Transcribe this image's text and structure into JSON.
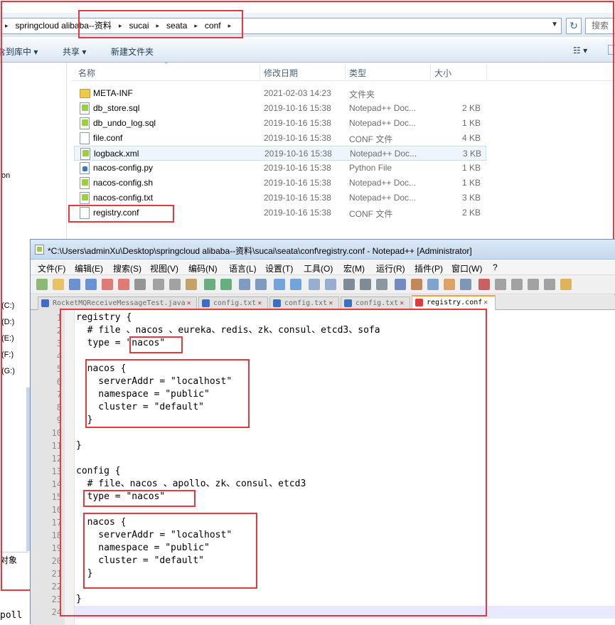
{
  "explorer": {
    "breadcrumb": [
      "springcloud alibaba--资料",
      "sucai",
      "seata",
      "conf"
    ],
    "search_placeholder": "搜索",
    "commands": [
      "含到库中 ▾",
      "共享 ▾",
      "新建文件夹"
    ],
    "left_pane": [
      "on",
      "(C:)",
      "(D:)",
      "(E:)",
      "(F:)",
      "(G:)"
    ],
    "status_left": "对象",
    "bottom_left": "poll",
    "columns": [
      "名称",
      "修改日期",
      "类型",
      "大小"
    ],
    "files": [
      {
        "name": "META-INF",
        "date": "2021-02-03 14:23",
        "type": "文件夹",
        "size": "",
        "icon": "folder-icon"
      },
      {
        "name": "db_store.sql",
        "date": "2019-10-16 15:38",
        "type": "Notepad++ Doc...",
        "size": "2 KB",
        "icon": "notepadpp-file-icon"
      },
      {
        "name": "db_undo_log.sql",
        "date": "2019-10-16 15:38",
        "type": "Notepad++ Doc...",
        "size": "1 KB",
        "icon": "notepadpp-file-icon"
      },
      {
        "name": "file.conf",
        "date": "2019-10-16 15:38",
        "type": "CONF 文件",
        "size": "4 KB",
        "icon": "document-icon"
      },
      {
        "name": "logback.xml",
        "date": "2019-10-16 15:38",
        "type": "Notepad++ Doc...",
        "size": "3 KB",
        "icon": "notepadpp-file-icon"
      },
      {
        "name": "nacos-config.py",
        "date": "2019-10-16 15:38",
        "type": "Python File",
        "size": "1 KB",
        "icon": "python-file-icon"
      },
      {
        "name": "nacos-config.sh",
        "date": "2019-10-16 15:38",
        "type": "Notepad++ Doc...",
        "size": "1 KB",
        "icon": "notepadpp-file-icon"
      },
      {
        "name": "nacos-config.txt",
        "date": "2019-10-16 15:38",
        "type": "Notepad++ Doc...",
        "size": "3 KB",
        "icon": "notepadpp-file-icon"
      },
      {
        "name": "registry.conf",
        "date": "2019-10-16 15:38",
        "type": "CONF 文件",
        "size": "2 KB",
        "icon": "document-icon"
      }
    ]
  },
  "notepad": {
    "title": "*C:\\Users\\adminXu\\Desktop\\springcloud alibaba--资料\\sucai\\seata\\conf\\registry.conf - Notepad++ [Administrator]",
    "menu": [
      "文件(F)",
      "编辑(E)",
      "搜索(S)",
      "视图(V)",
      "编码(N)",
      "语言(L)",
      "设置(T)",
      "工具(O)",
      "宏(M)",
      "运行(R)",
      "插件(P)",
      "窗口(W)",
      "?"
    ],
    "tabs": [
      "RocketMQReceiveMessageTest.java",
      "config.txt",
      "config.txt",
      "config.txt",
      "registry.conf"
    ],
    "active_tab": 4,
    "lines": [
      "registry {",
      "  # file 、nacos 、eureka、redis、zk、consul、etcd3、sofa",
      "  type = \"nacos\"",
      "",
      "  nacos {",
      "    serverAddr = \"localhost\"",
      "    namespace = \"public\"",
      "    cluster = \"default\"",
      "  }",
      "",
      "}",
      "",
      "config {",
      "  # file、nacos 、apollo、zk、consul、etcd3",
      "  type = \"nacos\"",
      "",
      "  nacos {",
      "    serverAddr = \"localhost\"",
      "    namespace = \"public\"",
      "    cluster = \"default\"",
      "  }",
      "",
      "}",
      ""
    ],
    "line_numbers": [
      "1",
      "2",
      "3",
      "4",
      "5",
      "6",
      "7",
      "8",
      "9",
      "10",
      "11",
      "12",
      "13",
      "14",
      "15",
      "16",
      "17",
      "18",
      "19",
      "20",
      "21",
      "22",
      "23",
      "24"
    ]
  },
  "colors": {
    "highlight": "#e8383d",
    "accent": "#f9a031"
  }
}
